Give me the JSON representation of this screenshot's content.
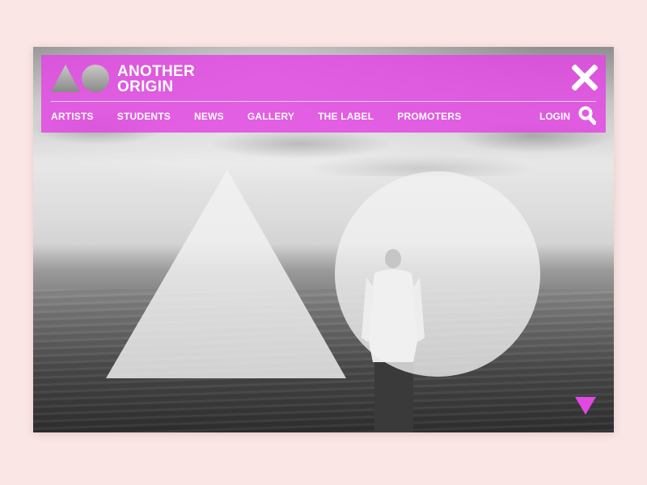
{
  "brand": {
    "line1": "ANOTHER",
    "line2": "ORIGIN"
  },
  "nav": {
    "items": [
      {
        "label": "ARTISTS"
      },
      {
        "label": "STUDENTS"
      },
      {
        "label": "NEWS"
      },
      {
        "label": "GALLERY"
      },
      {
        "label": "THE LABEL"
      },
      {
        "label": "PROMOTERS"
      }
    ],
    "login_label": "LOGIN"
  },
  "icons": {
    "logo": "triangle-circle-logo",
    "close": "close-x-icon",
    "search": "search-icon",
    "scroll": "down-triangle-icon"
  },
  "colors": {
    "accent": "#e248e2",
    "page_background": "#fbe6e6",
    "shape_overlay": "#f2f2f2"
  }
}
